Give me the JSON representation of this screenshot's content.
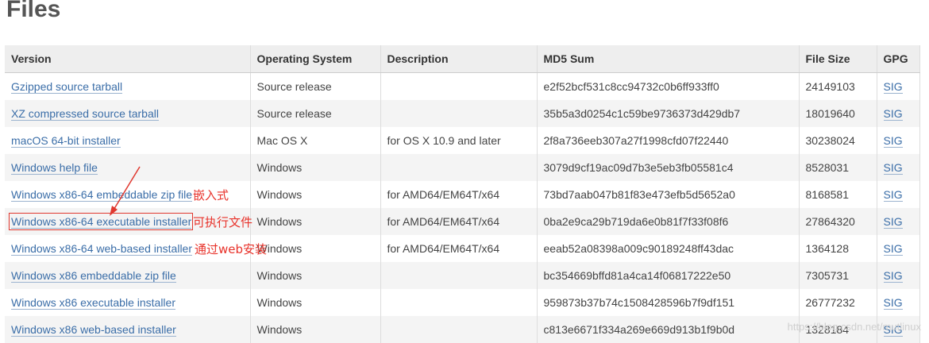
{
  "page": {
    "heading": "Files"
  },
  "table": {
    "columns": [
      "Version",
      "Operating System",
      "Description",
      "MD5 Sum",
      "File Size",
      "GPG"
    ],
    "rows": [
      {
        "version": "Gzipped source tarball",
        "os": "Source release",
        "description": "",
        "md5": "e2f52bcf531c8cc94732c0b6ff933ff0",
        "size": "24149103",
        "gpg": "SIG"
      },
      {
        "version": "XZ compressed source tarball",
        "os": "Source release",
        "description": "",
        "md5": "35b5a3d0254c1c59be9736373d429db7",
        "size": "18019640",
        "gpg": "SIG"
      },
      {
        "version": "macOS 64-bit installer",
        "os": "Mac OS X",
        "description": "for OS X 10.9 and later",
        "md5": "2f8a736eeb307a27f1998cfd07f22440",
        "size": "30238024",
        "gpg": "SIG"
      },
      {
        "version": "Windows help file",
        "os": "Windows",
        "description": "",
        "md5": "3079d9cf19ac09d7b3e5eb3fb05581c4",
        "size": "8528031",
        "gpg": "SIG"
      },
      {
        "version": "Windows x86-64 embeddable zip file",
        "os": "Windows",
        "description": "for AMD64/EM64T/x64",
        "md5": "73bd7aab047b81f83e473efb5d5652a0",
        "size": "8168581",
        "gpg": "SIG"
      },
      {
        "version": "Windows x86-64 executable installer",
        "os": "Windows",
        "description": "for AMD64/EM64T/x64",
        "md5": "0ba2e9ca29b719da6e0b81f7f33f08f6",
        "size": "27864320",
        "gpg": "SIG"
      },
      {
        "version": "Windows x86-64 web-based installer",
        "os": "Windows",
        "description": "for AMD64/EM64T/x64",
        "md5": "eeab52a08398a009c90189248ff43dac",
        "size": "1364128",
        "gpg": "SIG"
      },
      {
        "version": "Windows x86 embeddable zip file",
        "os": "Windows",
        "description": "",
        "md5": "bc354669bffd81a4ca14f06817222e50",
        "size": "7305731",
        "gpg": "SIG"
      },
      {
        "version": "Windows x86 executable installer",
        "os": "Windows",
        "description": "",
        "md5": "959873b37b74c1508428596b7f9df151",
        "size": "26777232",
        "gpg": "SIG"
      },
      {
        "version": "Windows x86 web-based installer",
        "os": "Windows",
        "description": "",
        "md5": "c813e6671f334a269e669d913b1f9b0d",
        "size": "1328184",
        "gpg": "SIG"
      }
    ]
  },
  "annotations": {
    "embeddable": "嵌入式",
    "executable": "可执行文件",
    "web_install": "通过web安装",
    "highlight_color": "#e0382f"
  },
  "watermark": "https://blog.csdn.net/mutlinux"
}
